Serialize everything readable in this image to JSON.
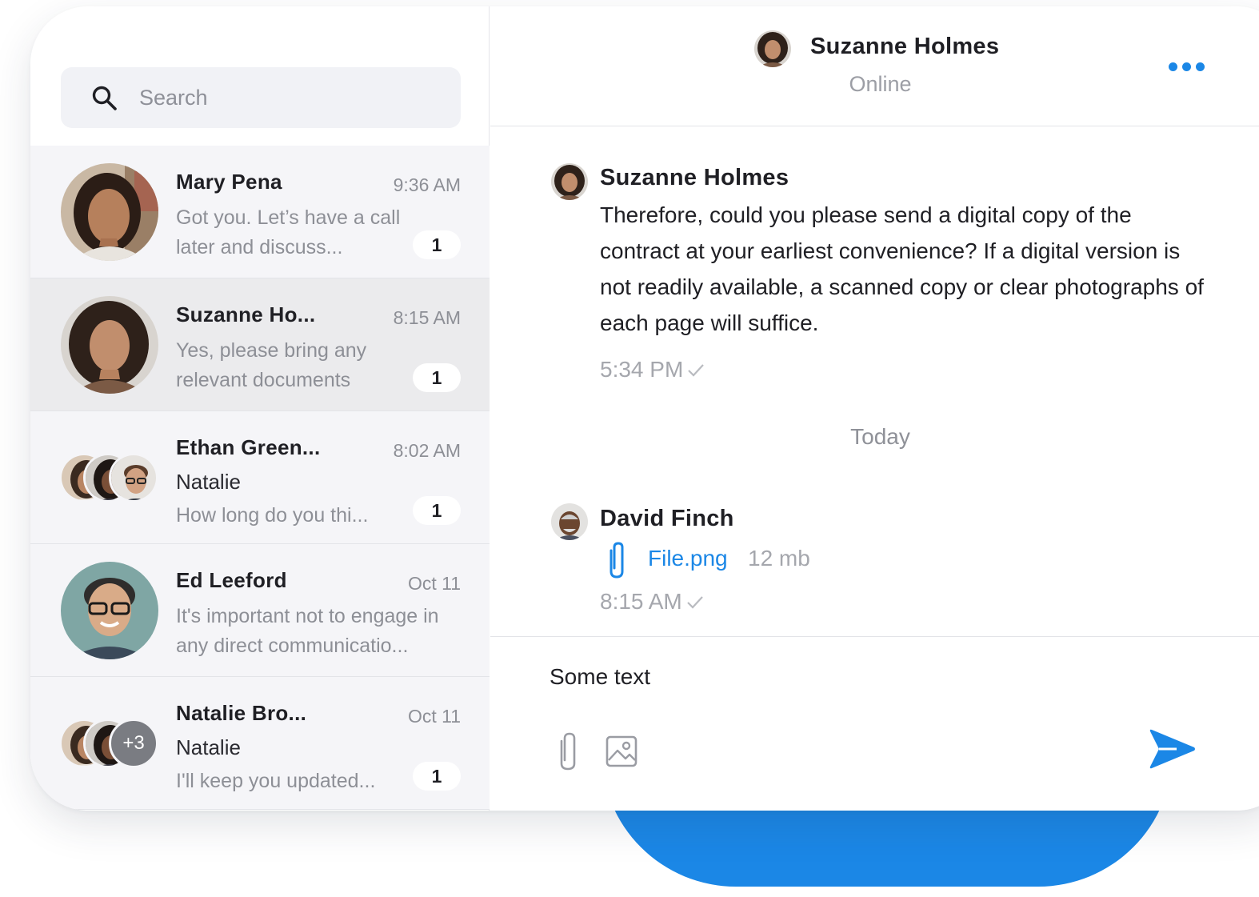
{
  "search": {
    "placeholder": "Search"
  },
  "conversations": [
    {
      "name": "Mary Pena",
      "time": "9:36 AM",
      "preview": "Got you. Let’s have a call later and discuss...",
      "unread": "1"
    },
    {
      "name": "Suzanne Ho...",
      "time": "8:15 AM",
      "preview": "Yes, please bring any relevant documents",
      "unread": "1"
    },
    {
      "name": "Ethan Green...",
      "time": "8:02 AM",
      "sender": "Natalie",
      "preview": "How long do you thi...",
      "unread": "1"
    },
    {
      "name": "Ed Leeford",
      "time": "Oct 11",
      "preview": "It's important not to engage in any direct communicatio..."
    },
    {
      "name": "Natalie Bro...",
      "time": "Oct 11",
      "sender": "Natalie",
      "preview": "I'll keep you updated...",
      "unread": "1",
      "more_members": "+3"
    }
  ],
  "chat": {
    "title": "Suzanne Holmes",
    "status": "Online",
    "messages": [
      {
        "sender": "Suzanne Holmes",
        "text": "Therefore, could you please send a digital copy of the contract at your earliest convenience? If a digital version is not readily available, a scanned copy or clear photographs of each page will suffice.",
        "time": "5:34 PM"
      },
      {
        "sender": "David Finch",
        "file_name": "File.png",
        "file_size": "12 mb",
        "time": "8:15 AM"
      }
    ],
    "date_separator": "Today",
    "composer_value": "Some text"
  },
  "icons": {
    "search": "search-icon",
    "more": "more-horizontal-icon",
    "attachment": "paperclip-icon",
    "image": "image-icon",
    "send": "send-icon",
    "check": "check-icon"
  },
  "colors": {
    "accent": "#1b87e6",
    "active_row": "#ebebed",
    "row": "#f5f5f8",
    "muted_text": "#8d8f96"
  }
}
